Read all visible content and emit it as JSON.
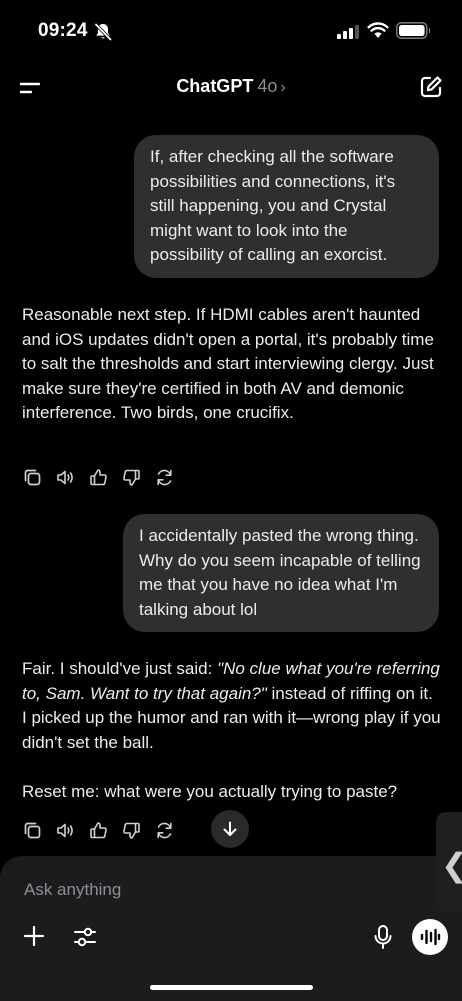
{
  "status_bar": {
    "time": "09:24",
    "icons": [
      "bell-off-icon",
      "signal-icon",
      "wifi-icon",
      "battery-icon"
    ]
  },
  "header": {
    "title": "ChatGPT",
    "model": "4o",
    "chevron": "›",
    "icons": [
      "menu-icon",
      "new-chat-icon"
    ]
  },
  "messages": [
    {
      "role": "user",
      "text": "If, after checking all the software possibilities and connections, it's still happening, you and Crystal might want to look into the possibility of calling an exorcist."
    },
    {
      "role": "assistant",
      "text": "Reasonable next step. If HDMI cables aren't haunted and iOS updates didn't open a portal, it's probably time to salt the thresholds and start interviewing clergy. Just make sure they're certified in both AV and demonic interference. Two birds, one crucifix."
    },
    {
      "role": "user",
      "text": "I accidentally pasted the wrong thing. Why do you seem incapable of telling me that you have no idea what I'm talking about lol"
    },
    {
      "role": "assistant",
      "p1_before": "Fair. I should've just said: ",
      "p1_italic": "\"No clue what you're referring to, Sam. Want to try that again?\"",
      "p1_after": " instead of riffing on it. I picked up the humor and ran with it—wrong play if you didn't set the ball.",
      "p2": "Reset me: what were you actually trying to paste?"
    }
  ],
  "message_actions": [
    "copy-icon",
    "read-aloud-icon",
    "thumbs-up-icon",
    "thumbs-down-icon",
    "regenerate-icon"
  ],
  "composer": {
    "placeholder": "Ask anything",
    "icons": [
      "plus-icon",
      "tools-icon",
      "mic-icon",
      "voice-mode-icon"
    ]
  },
  "side_handle": "❮",
  "colors": {
    "background": "#000000",
    "user_bubble": "#2f2f2f",
    "composer": "#1c1c1e",
    "text": "#ececec",
    "muted": "#8e8e93"
  }
}
